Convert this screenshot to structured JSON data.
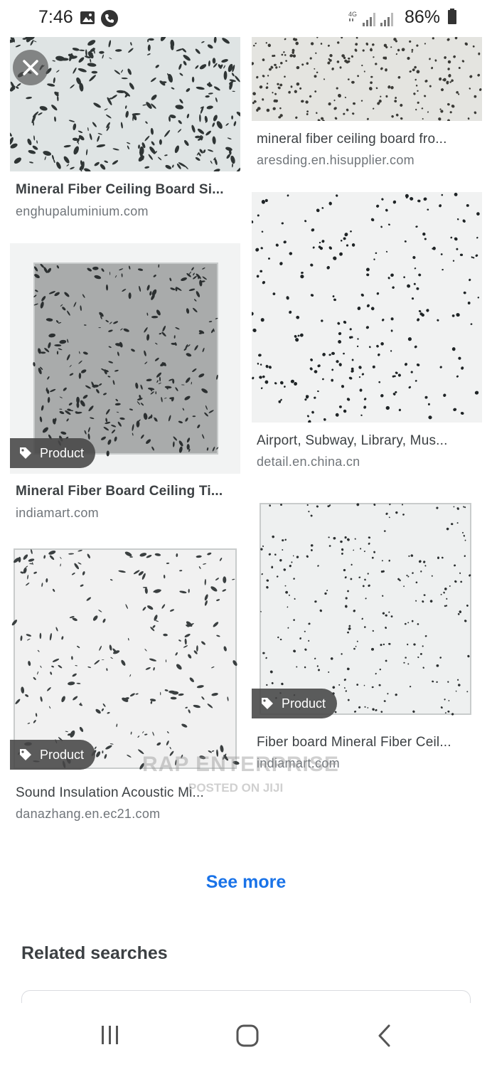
{
  "status_bar": {
    "time": "7:46",
    "network": "4G",
    "battery": "86%",
    "icons": [
      "image-icon",
      "phone-icon",
      "signal-icon",
      "battery-icon"
    ]
  },
  "results": [
    {
      "title": "Mineral Fiber Ceiling Board Si...",
      "source": "enghupaluminium.com",
      "badge": ""
    },
    {
      "title": "mineral fiber ceiling board fro...",
      "source": "aresding.en.hisupplier.com",
      "badge": ""
    },
    {
      "title": "Airport, Subway, Library, Mus...",
      "source": "detail.en.china.cn",
      "badge": ""
    },
    {
      "title": "Mineral Fiber Board Ceiling Ti...",
      "source": "indiamart.com",
      "badge": "Product"
    },
    {
      "title": "Fiber board Mineral Fiber Ceil...",
      "source": "indiamart.com",
      "badge": "Product"
    },
    {
      "title": "Sound Insulation Acoustic Mi...",
      "source": "danazhang.en.ec21.com",
      "badge": "Product"
    }
  ],
  "watermark": {
    "line1": "RAP ENTERPRISE",
    "line2": "POSTED ON JIJI"
  },
  "see_more": "See more",
  "related_searches": "Related searches",
  "colors": {
    "link": "#1a73e8",
    "title": "#3c4043",
    "source": "#70757a",
    "badge_bg": "#464646"
  },
  "nav": {
    "icons": [
      "recent-apps-icon",
      "home-icon",
      "back-icon"
    ]
  }
}
